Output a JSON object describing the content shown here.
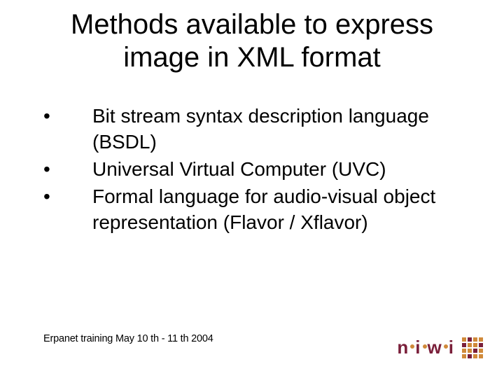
{
  "title_line1": "Methods available to express",
  "title_line2": "image in XML format",
  "bullets": [
    "Bit stream syntax description language (BSDL)",
    "Universal Virtual Computer (UVC)",
    "Formal language for audio-visual object representation (Flavor / Xflavor)"
  ],
  "footer": "Erpanet training May 10 th - 11 th 2004",
  "logo_text": "niwi"
}
